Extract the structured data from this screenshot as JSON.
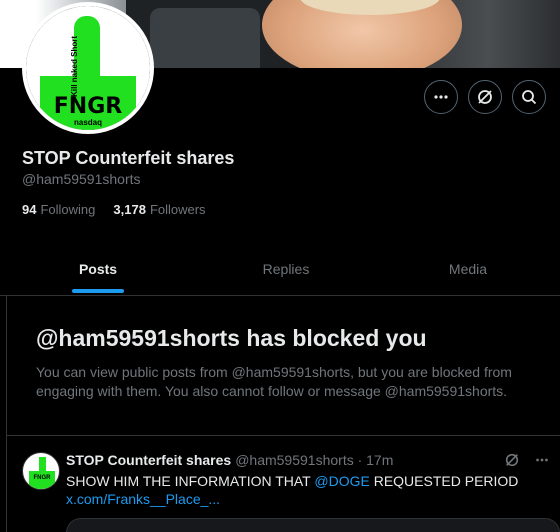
{
  "profile": {
    "name": "STOP Counterfeit shares",
    "handle": "@ham59591shorts",
    "following_count": "94",
    "following_label": "Following",
    "followers_count": "3,178",
    "followers_label": "Followers",
    "avatar_text_main": "FNGR",
    "avatar_text_vertical": "Kill naked Short",
    "avatar_text_small": "nasdaq"
  },
  "actions": {
    "more_icon": "more-icon",
    "grok_icon": "grok-icon",
    "search_icon": "search-icon"
  },
  "tabs": [
    {
      "label": "Posts",
      "active": true
    },
    {
      "label": "Replies",
      "active": false
    },
    {
      "label": "Media",
      "active": false
    }
  ],
  "blocked": {
    "title": "@ham59591shorts has blocked you",
    "description": "You can view public posts from @ham59591shorts, but you are blocked from engaging with them. You also cannot follow or message @ham59591shorts."
  },
  "post": {
    "name": "STOP Counterfeit shares",
    "meta": "@ham59591shorts · 17m",
    "text_before": "SHOW HIM THE INFORMATION THAT ",
    "mention": "@DOGE",
    "text_after": " REQUESTED PERIOD",
    "link": "x.com/Franks__Place_...",
    "avatar_text": "FNGR"
  },
  "colors": {
    "accent": "#1d9bf0",
    "background": "#000000",
    "secondary_text": "#71767b",
    "primary_text": "#e7e9ea",
    "avatar_green": "#20e020"
  }
}
